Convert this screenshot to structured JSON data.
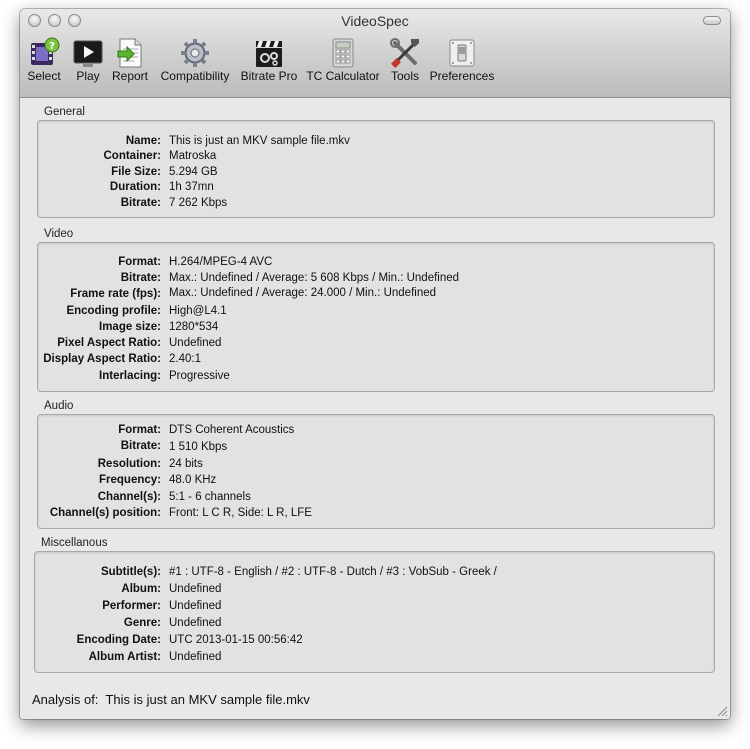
{
  "window": {
    "title": "VideoSpec"
  },
  "toolbar": [
    {
      "label": "Select",
      "icon": "film-question-icon"
    },
    {
      "label": "Play",
      "icon": "play-screen-icon"
    },
    {
      "label": "Report",
      "icon": "report-document-icon"
    },
    {
      "label": "Compatibility",
      "icon": "gear-icon"
    },
    {
      "label": "Bitrate Pro",
      "icon": "clapperboard-icon"
    },
    {
      "label": "TC Calculator",
      "icon": "calculator-icon"
    },
    {
      "label": "Tools",
      "icon": "tools-icon"
    },
    {
      "label": "Preferences",
      "icon": "switch-icon"
    }
  ],
  "general": {
    "title": "General",
    "rows": [
      {
        "key": "Name:",
        "value": "This is just an MKV sample file.mkv"
      },
      {
        "key": "Container:",
        "value": "Matroska"
      },
      {
        "key": "File Size:",
        "value": "5.294 GB"
      },
      {
        "key": "Duration:",
        "value": "1h 37mn"
      },
      {
        "key": "Bitrate:",
        "value": "7 262 Kbps"
      }
    ]
  },
  "video": {
    "title": "Video",
    "rows": [
      {
        "key": "Format:",
        "value": "H.264/MPEG-4 AVC"
      },
      {
        "key": "Bitrate:",
        "value": "Max.: Undefined / Average: 5 608 Kbps / Min.: Undefined"
      },
      {
        "key": "Frame rate (fps):",
        "value": "Max.: Undefined / Average: 24.000 / Min.: Undefined"
      },
      {
        "key": "Encoding profile:",
        "value": "High@L4.1"
      },
      {
        "key": "Image size:",
        "value": "1280*534"
      },
      {
        "key": "Pixel Aspect Ratio:",
        "value": "Undefined"
      },
      {
        "key": "Display Aspect Ratio:",
        "value": "2.40:1"
      },
      {
        "key": "Interlacing:",
        "value": "Progressive"
      }
    ]
  },
  "audio": {
    "title": "Audio",
    "rows": [
      {
        "key": "Format:",
        "value": "DTS Coherent Acoustics"
      },
      {
        "key": "Bitrate:",
        "value": "1 510 Kbps"
      },
      {
        "key": "Resolution:",
        "value": "24 bits"
      },
      {
        "key": "Frequency:",
        "value": "48.0 KHz"
      },
      {
        "key": "Channel(s):",
        "value": "5:1 - 6 channels"
      },
      {
        "key": "Channel(s) position:",
        "value": "Front: L C R, Side: L R, LFE"
      }
    ]
  },
  "misc": {
    "title": "Miscellanous",
    "rows": [
      {
        "key": "Subtitle(s):",
        "value": "#1 : UTF-8 - English / #2 : UTF-8 - Dutch / #3 : VobSub - Greek /"
      },
      {
        "key": "Album:",
        "value": "Undefined"
      },
      {
        "key": "Performer:",
        "value": "Undefined"
      },
      {
        "key": "Genre:",
        "value": "Undefined"
      },
      {
        "key": "Encoding Date:",
        "value": "UTC 2013-01-15 00:56:42"
      },
      {
        "key": "Album Artist:",
        "value": "Undefined"
      }
    ]
  },
  "footer": {
    "label": "Analysis of:",
    "file": "This is just an MKV sample file.mkv"
  }
}
